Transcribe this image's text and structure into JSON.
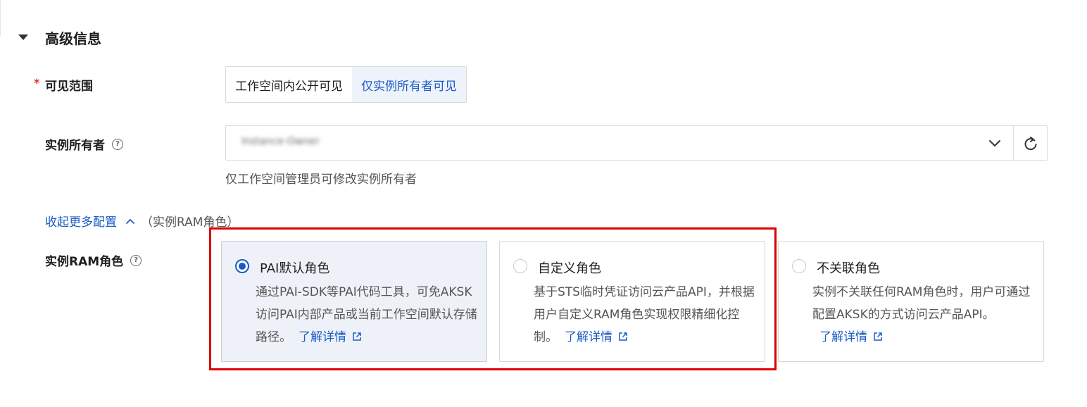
{
  "section": {
    "title": "高级信息"
  },
  "visibility": {
    "label": "可见范围",
    "required_mark": "*",
    "options": [
      "工作空间内公开可见",
      "仅实例所有者可见"
    ],
    "selected": "仅实例所有者可见"
  },
  "owner": {
    "label": "实例所有者",
    "help_icon": "question-circle-icon",
    "value": "Instance-Owner",
    "helper": "仅工作空间管理员可修改实例所有者"
  },
  "collapse": {
    "link": "收起更多配置",
    "note": "（实例RAM角色）"
  },
  "ram_role": {
    "label": "实例RAM角色",
    "help_icon": "question-circle-icon",
    "selected": "PAI默认角色",
    "options": [
      {
        "title": "PAI默认角色",
        "desc": "通过PAI-SDK等PAI代码工具，可免AKSK访问PAI内部产品或当前工作空间默认存储路径。",
        "link": "了解详情"
      },
      {
        "title": "自定义角色",
        "desc": "基于STS临时凭证访问云产品API，并根据用户自定义RAM角色实现权限精细化控制。",
        "link": "了解详情"
      },
      {
        "title": "不关联角色",
        "desc": "实例不关联任何RAM角色时，用户可通过配置AKSK的方式访问云产品API。",
        "link": "了解详情"
      }
    ]
  },
  "colors": {
    "accent": "#1a5bc4",
    "highlight_border": "#e00000",
    "selected_bg": "#eef2f8"
  }
}
